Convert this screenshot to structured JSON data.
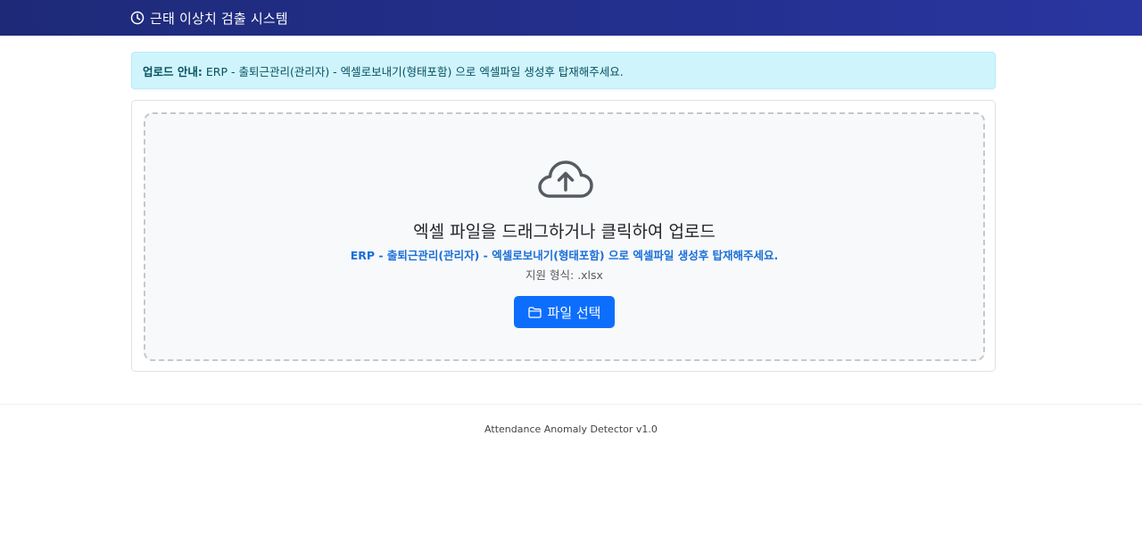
{
  "navbar": {
    "title": "근태 이상치 검출 시스템",
    "icon": "clock-icon"
  },
  "alert": {
    "label": "업로드 안내:",
    "message": "ERP - 출퇴근관리(관리자) - 엑셀로보내기(형태포함) 으로 엑셀파일 생성후 탑재해주세요."
  },
  "dropzone": {
    "icon": "cloud-upload-icon",
    "title": "엑셀 파일을 드래그하거나 클릭하여 업로드",
    "hint": "ERP - 출퇴근관리(관리자) - 엑셀로보내기(형태포함) 으로 엑셀파일 생성후 탑재해주세요.",
    "format": "지원 형식: .xlsx",
    "button_label": "파일 선택",
    "button_icon": "folder-icon"
  },
  "footer": {
    "text": "Attendance Anomaly Detector v1.0"
  },
  "colors": {
    "navbar": "#24308f",
    "alert_bg": "#cff4fc",
    "primary": "#0d6efd",
    "hint": "#1a6fd8"
  }
}
